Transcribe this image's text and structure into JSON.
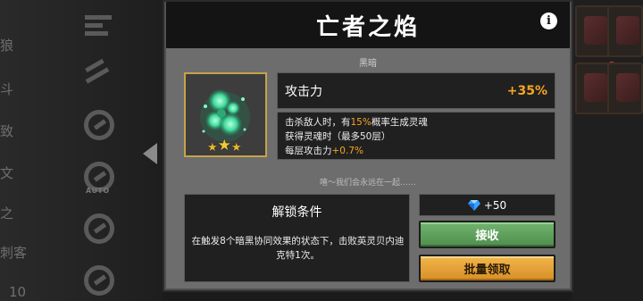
{
  "background": {
    "left_labels": [
      "狼",
      "斗",
      "致",
      "文",
      "之",
      "刺客",
      "10"
    ],
    "left_icons": [
      "wrench-icon",
      "scroll-icon",
      "no-entry-icon",
      "auto-icon",
      "no-entry-icon"
    ]
  },
  "dialog": {
    "title": "亡者之焰",
    "info_icon": "i",
    "series": "黑暗",
    "item": {
      "icon": "green-spirit-flame-icon",
      "stars": 3
    },
    "stat": {
      "name": "攻击力",
      "value": "+35%"
    },
    "description": {
      "line1_pre": "击杀敌人时，有",
      "line1_hl": "15%",
      "line1_post": "概率生成灵魂",
      "line2": "获得灵魂时（最多50层）",
      "line3_pre": "每层攻击力",
      "line3_hl": "+0.7%"
    },
    "quote": "嘻～我们会永远在一起……",
    "unlock": {
      "title": "解锁条件",
      "description": "在触发8个暗黑协同效果的状态下，击败英灵贝内迪克特1次。"
    },
    "reward": {
      "icon": "diamond-gem-icon",
      "amount": "+50"
    },
    "buttons": {
      "claim": "接收",
      "batch_claim": "批量领取"
    }
  },
  "colors": {
    "highlight": "#f5a623",
    "claim_green": "#5f9f5c",
    "batch_orange": "#e6a238",
    "frame_gold": "#c7a24a"
  }
}
